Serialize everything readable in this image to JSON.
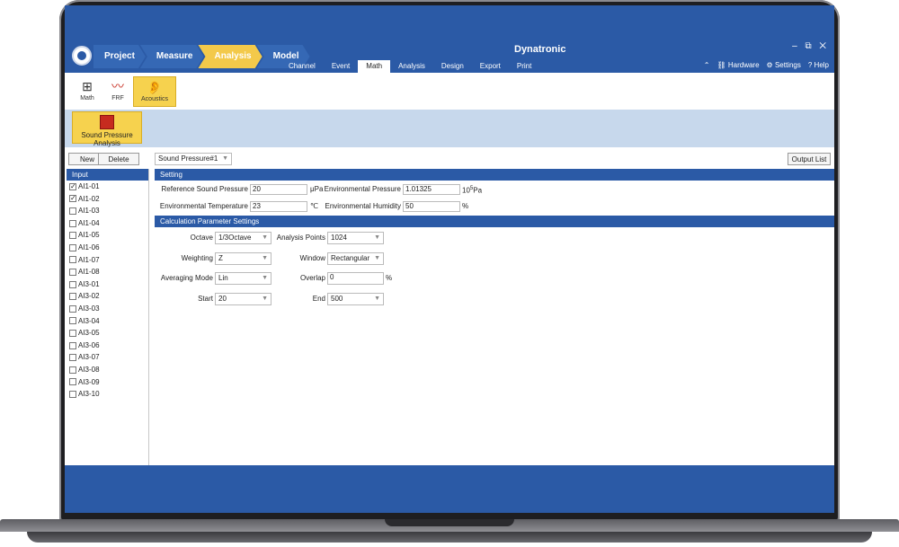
{
  "window": {
    "title": "Dynatronic",
    "controls": "– ⧉ ✕"
  },
  "breadcrumbs": [
    "Project",
    "Measure",
    "Analysis",
    "Model"
  ],
  "menu_tabs": [
    "Channel",
    "Event",
    "Math",
    "Analysis",
    "Design",
    "Export",
    "Print"
  ],
  "right_tools": {
    "hardware": "Hardware",
    "settings": "Settings",
    "help": "Help"
  },
  "ribbon": {
    "math": "Math",
    "frf": "FRF",
    "acoustics": "Acoustics"
  },
  "subribbon": {
    "sound_pressure_analysis": "Sound Pressure Analysis"
  },
  "toolbar": {
    "new": "New",
    "delete": "Delete",
    "selected_analysis": "Sound Pressure#1",
    "output_list": "Output List"
  },
  "input_panel": {
    "title": "Input",
    "items": [
      {
        "label": "AI1-01",
        "checked": true
      },
      {
        "label": "AI1-02",
        "checked": true
      },
      {
        "label": "AI1-03",
        "checked": false
      },
      {
        "label": "AI1-04",
        "checked": false
      },
      {
        "label": "AI1-05",
        "checked": false
      },
      {
        "label": "AI1-06",
        "checked": false
      },
      {
        "label": "AI1-07",
        "checked": false
      },
      {
        "label": "AI1-08",
        "checked": false
      },
      {
        "label": "AI3-01",
        "checked": false
      },
      {
        "label": "AI3-02",
        "checked": false
      },
      {
        "label": "AI3-03",
        "checked": false
      },
      {
        "label": "AI3-04",
        "checked": false
      },
      {
        "label": "AI3-05",
        "checked": false
      },
      {
        "label": "AI3-06",
        "checked": false
      },
      {
        "label": "AI3-07",
        "checked": false
      },
      {
        "label": "AI3-08",
        "checked": false
      },
      {
        "label": "AI3-09",
        "checked": false
      },
      {
        "label": "AI3-10",
        "checked": false
      }
    ]
  },
  "setting": {
    "title": "Setting",
    "ref_pressure_label": "Reference Sound Pressure",
    "ref_pressure_value": "20",
    "ref_pressure_unit": "μPa",
    "env_pressure_label": "Environmental Pressure",
    "env_pressure_value": "1.01325",
    "env_pressure_unit_base": "10",
    "env_pressure_unit_exp": "5",
    "env_pressure_unit_suffix": "Pa",
    "env_temp_label": "Environmental Temperature",
    "env_temp_value": "23",
    "env_temp_unit": "℃",
    "env_humidity_label": "Environmental Humidity",
    "env_humidity_value": "50",
    "env_humidity_unit": "%"
  },
  "calc": {
    "title": "Calculation Parameter Settings",
    "octave_label": "Octave",
    "octave_value": "1/3Octave",
    "analysis_points_label": "Analysis Points",
    "analysis_points_value": "1024",
    "weighting_label": "Weighting",
    "weighting_value": "Z",
    "window_label": "Window",
    "window_value": "Rectangular",
    "averaging_label": "Averaging Mode",
    "averaging_value": "Lin",
    "overlap_label": "Overlap",
    "overlap_value": "0",
    "overlap_unit": "%",
    "start_label": "Start",
    "start_value": "20",
    "end_label": "End",
    "end_value": "500"
  },
  "colors": {
    "brand_blue": "#2b5aa6",
    "accent_yellow": "#f6d24e",
    "ribbon_band": "#c7d8ec"
  }
}
